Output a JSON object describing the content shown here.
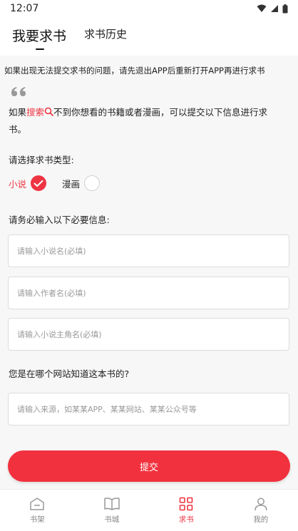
{
  "status": {
    "time": "12:07"
  },
  "tabs": [
    {
      "label": "我要求书"
    },
    {
      "label": "求书历史"
    }
  ],
  "notice": "如果出现无法提交求书的问题，请先退出APP后重新打开APP再进行求书",
  "intro": {
    "prefix": "如果",
    "search_label": "搜索",
    "suffix": "不到你想看的书籍或者漫画，可以提交以下信息进行求书。"
  },
  "type_section": {
    "label": "请选择求书类型:",
    "options": [
      {
        "label": "小说",
        "selected": true
      },
      {
        "label": "漫画",
        "selected": false
      }
    ]
  },
  "info_section": {
    "label": "请务必输入以下必要信息:",
    "fields": [
      {
        "placeholder": "请输入小说名(必填)"
      },
      {
        "placeholder": "请输入作者名(必填)"
      },
      {
        "placeholder": "请输入小说主角名(必填)"
      }
    ]
  },
  "source_section": {
    "label": "您是在哪个网站知道这本书的?",
    "placeholder": "请输入来源，如某某APP、某某网站、某某公众号等"
  },
  "submit_label": "提交",
  "nav": [
    {
      "label": "书架",
      "icon": "bookshelf-icon",
      "active": false
    },
    {
      "label": "书城",
      "icon": "book-icon",
      "active": false
    },
    {
      "label": "求书",
      "icon": "grid-icon",
      "active": true
    },
    {
      "label": "我的",
      "icon": "profile-icon",
      "active": false
    }
  ],
  "colors": {
    "accent": "#ee3442",
    "button": "#f2313e"
  }
}
